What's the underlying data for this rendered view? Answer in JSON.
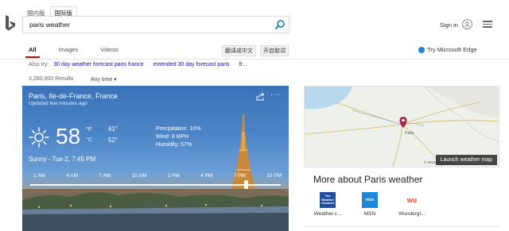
{
  "region_tabs": [
    "国内版",
    "国际版"
  ],
  "search": {
    "value": "paris weather"
  },
  "header": {
    "signin": "Sign in"
  },
  "nav": {
    "tabs": [
      "All",
      "Images",
      "Videos"
    ]
  },
  "translate_buttons": [
    "翻译成中文",
    "开启取词"
  ],
  "try_edge": "Try Microsoft Edge",
  "also_try": {
    "label": "Also try:",
    "links": [
      "30 day weather forecast paris france",
      "extended 30 day forecast paris",
      "fr..."
    ]
  },
  "results": {
    "count": "3,280,000 Results",
    "filter": "Any time"
  },
  "weather": {
    "location": "Paris, Ile-de-France, France",
    "updated": "Updated few minutes ago",
    "temperature": "58",
    "unit_f": "°F",
    "unit_c": "°C",
    "high": "61°",
    "low": "52°",
    "precipitation": "Precipitation: 10%",
    "wind": "Wind: 8 MPH",
    "humidity": "Humidity: 57%",
    "datetime": "Sunny - Tue 2, 7:45 PM",
    "hours": [
      "1 AM",
      "4 AM",
      "7 AM",
      "10 AM",
      "1 PM",
      "4 PM",
      "7 PM",
      "10 PM"
    ],
    "slider_position": 0.86
  },
  "map": {
    "launch": "Launch weather map",
    "copyright": "© 2019 Microsoft",
    "city_label": "Paris"
  },
  "more_about": "More about Paris weather",
  "sources": [
    {
      "label": "Weather.c...",
      "color": "#1f4e9c",
      "logo_text": "The Weather Channel"
    },
    {
      "label": "MSN",
      "color": "#1e88d8",
      "logo_text": "msn"
    },
    {
      "label": "Wundergr...",
      "color": "#ffffff",
      "logo_text": "wu"
    }
  ],
  "colors": {
    "accent": "#c00000",
    "link": "#1a0dab",
    "search_icon": "#0078d7"
  }
}
